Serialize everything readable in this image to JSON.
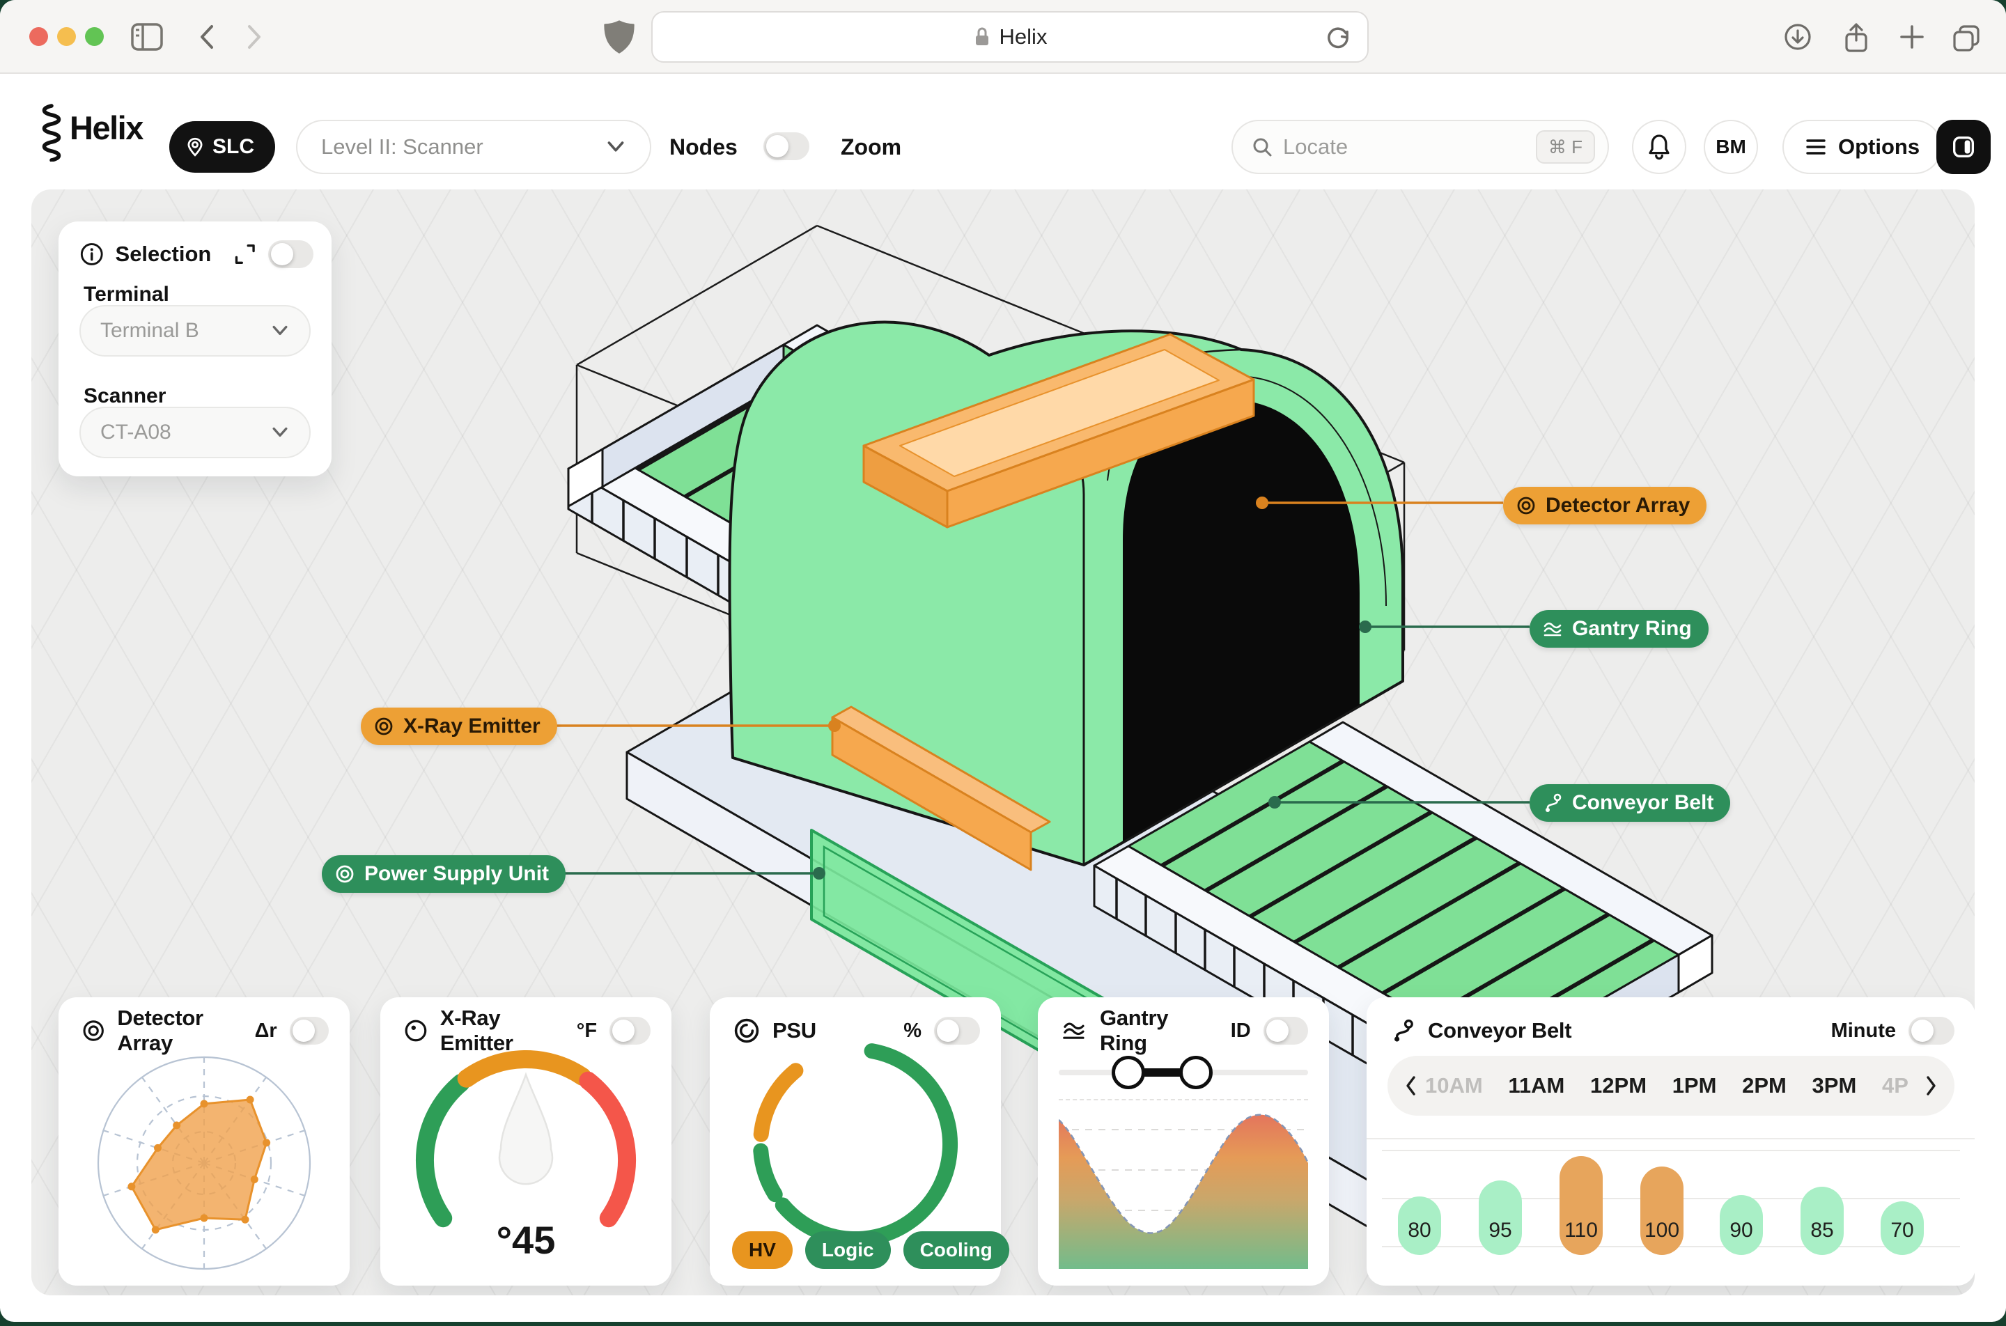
{
  "window": {
    "address": "Helix"
  },
  "header": {
    "brand": "Helix",
    "location_badge": "SLC",
    "level_selector": "Level II: Scanner",
    "nodes_label": "Nodes",
    "nodes_on": false,
    "zoom_label": "Zoom",
    "zoom_position": 0.5,
    "locate_placeholder": "Locate",
    "locate_shortcut": "⌘ F",
    "avatar": "BM",
    "options_label": "Options"
  },
  "selection": {
    "title": "Selection",
    "enabled": false,
    "terminal_label": "Terminal",
    "terminal_value": "Terminal B",
    "scanner_label": "Scanner",
    "scanner_value": "CT-A08"
  },
  "callouts": [
    {
      "label": "Detector Array",
      "style": "orange"
    },
    {
      "label": "Gantry Ring",
      "style": "green"
    },
    {
      "label": "X-Ray Emitter",
      "style": "orange"
    },
    {
      "label": "Conveyor Belt",
      "style": "green"
    },
    {
      "label": "Power Supply Unit",
      "style": "green"
    }
  ],
  "cards": {
    "detector": {
      "title": "Detector Array",
      "unit": "Δr",
      "toggle_on": false,
      "radar": {
        "values": [
          0.56,
          0.74,
          0.62,
          0.5,
          0.66,
          0.52,
          0.78,
          0.72,
          0.46,
          0.44
        ],
        "fill": "#F0A14C",
        "stroke": "#E8922C"
      }
    },
    "xray": {
      "title": "X-Ray Emitter",
      "unit": "°F",
      "toggle_on": false,
      "reading": "°45",
      "gauge_segments": [
        "#2E9E57",
        "#E8951F",
        "#F4564A"
      ]
    },
    "psu": {
      "title": "PSU",
      "unit": "%",
      "toggle_on": false,
      "ring_segments": [
        {
          "from": 10,
          "to": 230,
          "color": "#2E9E57"
        },
        {
          "from": 238,
          "to": 266,
          "color": "#2E9E57"
        },
        {
          "from": 276,
          "to": 321,
          "color": "#E8951F"
        }
      ],
      "badges": [
        {
          "label": "HV",
          "bg": "#E8951F",
          "fg": "#241503"
        },
        {
          "label": "Logic",
          "bg": "#2E8F5B",
          "fg": "#FFFFFF"
        },
        {
          "label": "Cooling",
          "bg": "#2E8F5B",
          "fg": "#FFFFFF"
        }
      ]
    },
    "gantry": {
      "title": "Gantry Ring",
      "unit": "ID",
      "toggle_on": false,
      "range": {
        "from": 0.28,
        "to": 0.55
      }
    },
    "conveyor": {
      "title": "Conveyor Belt",
      "unit": "Minute",
      "toggle_on": false,
      "times": [
        {
          "label": "10AM",
          "muted": true
        },
        {
          "label": "11AM",
          "muted": false
        },
        {
          "label": "12PM",
          "muted": false
        },
        {
          "label": "1PM",
          "muted": false
        },
        {
          "label": "2PM",
          "muted": false
        },
        {
          "label": "3PM",
          "muted": false
        },
        {
          "label": "4P",
          "muted": true
        }
      ],
      "bars": [
        {
          "value": 80,
          "height": 72,
          "color": "#A9EFC6"
        },
        {
          "value": 95,
          "height": 95,
          "color": "#A9EFC6"
        },
        {
          "value": 110,
          "height": 130,
          "color": "#E7A55C"
        },
        {
          "value": 100,
          "height": 115,
          "color": "#E7A55C"
        },
        {
          "value": 90,
          "height": 74,
          "color": "#A9EFC6"
        },
        {
          "value": 85,
          "height": 86,
          "color": "#A9EFC6"
        },
        {
          "value": 70,
          "height": 65,
          "color": "#A9EFC6"
        }
      ]
    }
  },
  "colors": {
    "accent_orange": "#E8962F",
    "accent_green": "#2E8F5B",
    "scene_green": "#8BE9A8",
    "belt_green": "#7FE096",
    "red": "#F4564A"
  }
}
